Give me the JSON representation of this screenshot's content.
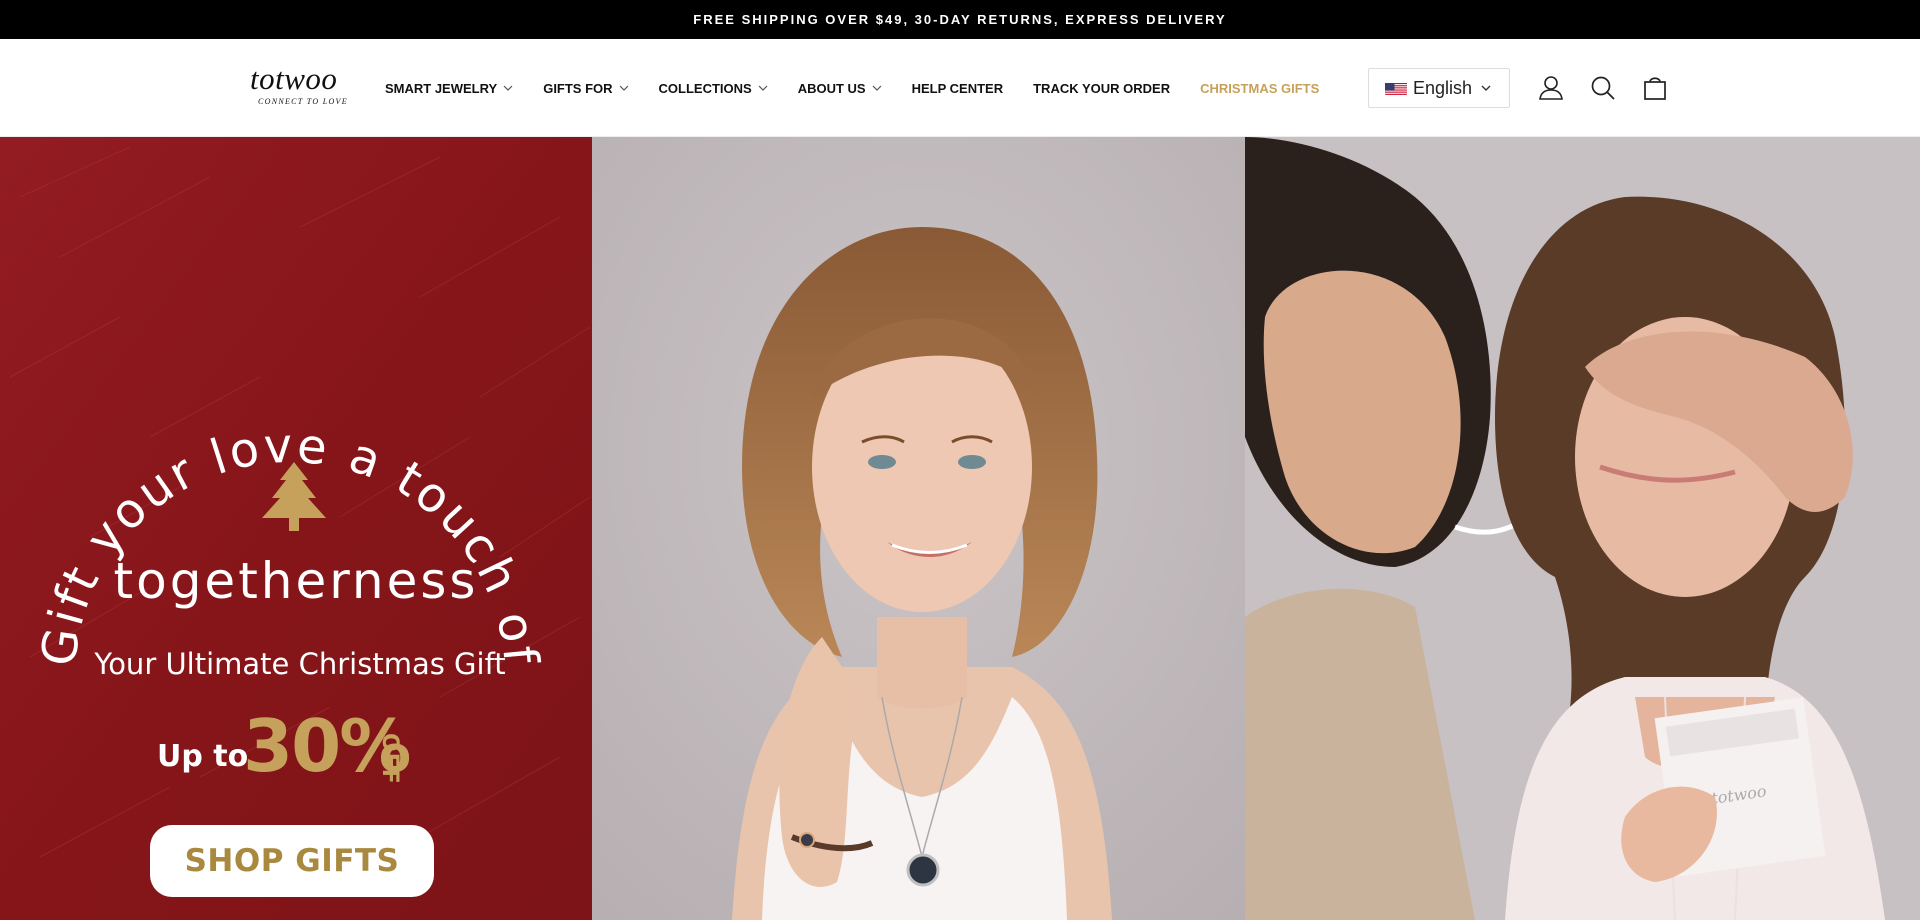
{
  "announcement": "FREE SHIPPING OVER $49, 30-DAY RETURNS, EXPRESS DELIVERY",
  "logo": {
    "name": "totwoo",
    "tagline": "CONNECT TO LOVE"
  },
  "nav": {
    "items": [
      {
        "label": "SMART JEWELRY",
        "has_dropdown": true
      },
      {
        "label": "GIFTS FOR",
        "has_dropdown": true
      },
      {
        "label": "COLLECTIONS",
        "has_dropdown": true
      },
      {
        "label": "ABOUT US",
        "has_dropdown": true
      },
      {
        "label": "HELP CENTER",
        "has_dropdown": false
      },
      {
        "label": "TRACK YOUR ORDER",
        "has_dropdown": false
      },
      {
        "label": "CHRISTMAS GIFTS",
        "has_dropdown": false,
        "accent": true
      }
    ]
  },
  "language": {
    "selected": "English",
    "flag": "us-flag-icon"
  },
  "header_icons": [
    "account-icon",
    "search-icon",
    "cart-icon"
  ],
  "hero": {
    "arc_text": "Gift your love a touch of",
    "headline": "togetherness",
    "subheadline": "Your Ultimate Christmas Gift",
    "discount_prefix": "Up to",
    "discount_value": "30%",
    "discount_suffix": "OFF",
    "cta": "SHOP GIFTS",
    "box_logo": "totwoo"
  },
  "colors": {
    "announcement_bg": "#000000",
    "accent_gold": "#c6a15b",
    "hero_red": "#8d1a1f",
    "cta_text": "#a8893e"
  }
}
